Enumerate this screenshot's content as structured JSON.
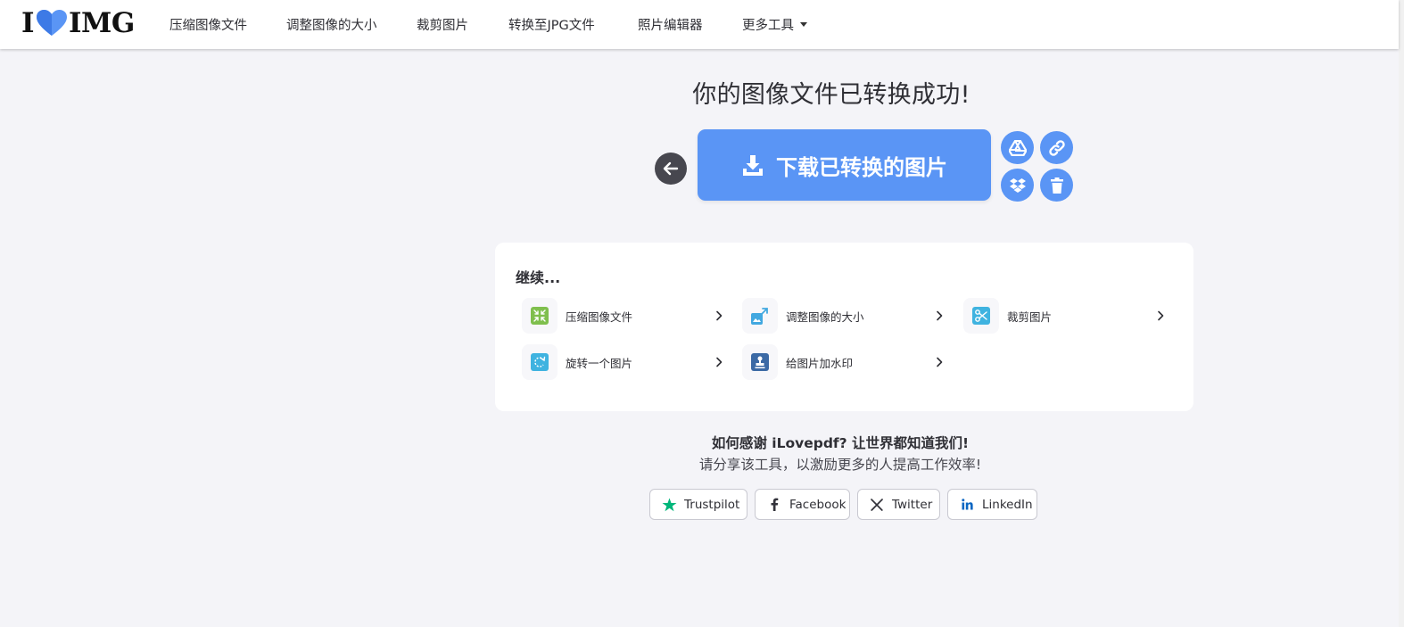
{
  "header": {
    "logo_left": "I",
    "logo_right": "IMG",
    "nav": [
      {
        "label": "压缩图像文件"
      },
      {
        "label": "调整图像的大小"
      },
      {
        "label": "裁剪图片"
      },
      {
        "label": "转换至JPG文件"
      },
      {
        "label": "照片编辑器"
      },
      {
        "label": "更多工具"
      }
    ]
  },
  "main": {
    "title": "你的图像文件已转换成功!",
    "download_label": "下载已转换的图片"
  },
  "continue": {
    "title": "继续...",
    "tools": [
      {
        "label": "压缩图像文件",
        "icon": "compress-icon",
        "color": "#7fbf4d"
      },
      {
        "label": "调整图像的大小",
        "icon": "resize-icon",
        "color": "#42a8e0"
      },
      {
        "label": "裁剪图片",
        "icon": "scissors-icon",
        "color": "#3fb3e0"
      },
      {
        "label": "旋转一个图片",
        "icon": "rotate-icon",
        "color": "#3fb3e0"
      },
      {
        "label": "给图片加水印",
        "icon": "stamp-icon",
        "color": "#3c6aa5"
      }
    ]
  },
  "share": {
    "title": "如何感谢 iLovepdf?  让世界都知道我们!",
    "subtitle": "请分享该工具，以激励更多的人提高工作效率!",
    "buttons": [
      {
        "label": "Trustpilot",
        "icon": "trustpilot-star-icon",
        "color": "#00b67a"
      },
      {
        "label": "Facebook",
        "icon": "facebook-icon",
        "color": "#33333b"
      },
      {
        "label": "Twitter",
        "icon": "x-twitter-icon",
        "color": "#33333b"
      },
      {
        "label": "LinkedIn",
        "icon": "linkedin-icon",
        "color": "#0a66c2"
      }
    ]
  },
  "colors": {
    "accent": "#5a95f5",
    "page_background": "#f4f4f8",
    "back_button": "#47474f"
  }
}
